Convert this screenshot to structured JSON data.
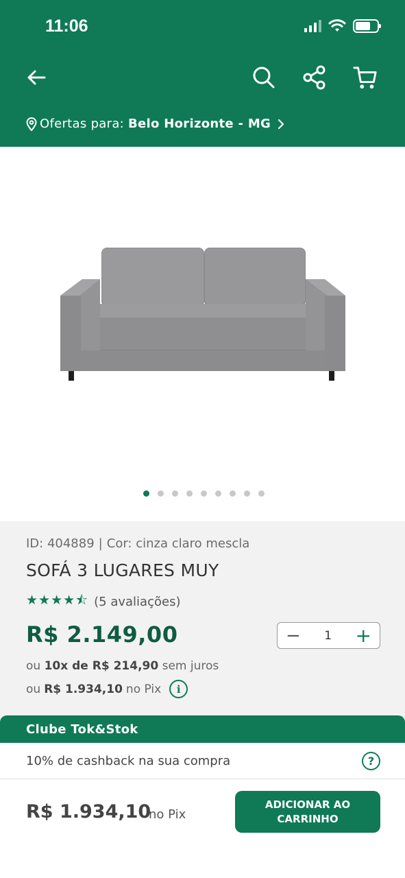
{
  "status_bar": {
    "time": "11:06"
  },
  "header": {
    "location_prefix": "Ofertas para:",
    "location_city": "Belo Horizonte - MG"
  },
  "icons": {
    "back": "arrow-left-icon",
    "search": "search-icon",
    "share": "share-icon",
    "cart": "cart-icon",
    "location": "location-pin-icon",
    "chevron": "chevron-right-icon"
  },
  "gallery": {
    "image_count": 9,
    "active_index": 0
  },
  "product": {
    "id_label": "ID: 404889",
    "color_label": "Cor: cinza claro mescla",
    "title": "SOFÁ 3 LUGARES MUY",
    "rating_value": 4.5,
    "rating_stars": "★★★★⯪",
    "reviews": "(5 avaliações)",
    "price": "R$ 2.149,00",
    "quantity": "1",
    "installments_prefix": "ou",
    "installments_value": "10x de R$ 214,90",
    "installments_suffix": "sem juros",
    "pix_prefix": "ou",
    "pix_value": "R$ 1.934,10",
    "pix_suffix": "no Pix",
    "info_symbol": "i"
  },
  "club": {
    "title": "Clube Tok&Stok",
    "cashback": "10% de cashback na sua compra",
    "help_symbol": "?"
  },
  "footer": {
    "price": "R$ 1.934,10",
    "pix_label": "no Pix",
    "add_button": "ADICIONAR AO CARRINHO"
  },
  "colors": {
    "brand_green": "#0f7a55",
    "price_green": "#0f5c41"
  }
}
